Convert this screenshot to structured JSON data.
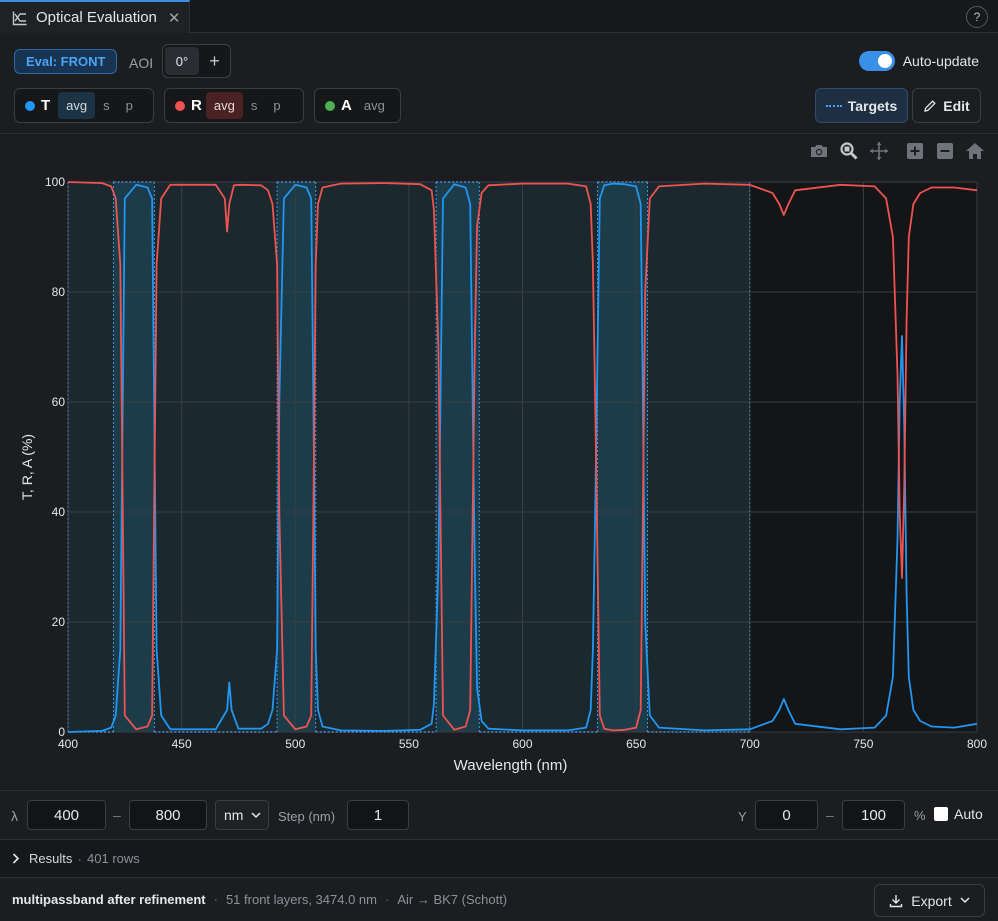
{
  "tab": {
    "title": "Optical Evaluation",
    "close": "✕",
    "help": "?"
  },
  "toolbar": {
    "eval_label": "Eval: FRONT",
    "aoi_label": "AOI",
    "aoi_value": "0°",
    "aoi_add": "+",
    "auto_update_label": "Auto-update",
    "auto_update_on": true,
    "channels": [
      {
        "letter": "T",
        "color": "#2196f3",
        "options": [
          "avg",
          "s",
          "p"
        ],
        "active": "avg"
      },
      {
        "letter": "R",
        "color": "#ef5350",
        "options": [
          "avg",
          "s",
          "p"
        ],
        "active": "avg"
      },
      {
        "letter": "A",
        "color": "#4caf50",
        "options": [
          "avg"
        ],
        "active": ""
      }
    ],
    "targets_label": "Targets",
    "edit_label": "Edit"
  },
  "chart_data": {
    "type": "line",
    "xlabel": "Wavelength (nm)",
    "ylabel": "T, R, A (%)",
    "xlim": [
      400,
      800
    ],
    "ylim": [
      0,
      100
    ],
    "xticks": [
      400,
      450,
      500,
      550,
      600,
      650,
      700,
      750,
      800
    ],
    "yticks": [
      0,
      20,
      40,
      60,
      80,
      100
    ],
    "grid": true,
    "target_bands": [
      {
        "x0": 400,
        "x1": 420,
        "type": "stop"
      },
      {
        "x0": 420,
        "x1": 438,
        "type": "pass"
      },
      {
        "x0": 438,
        "x1": 492,
        "type": "stop"
      },
      {
        "x0": 492,
        "x1": 509,
        "type": "pass"
      },
      {
        "x0": 509,
        "x1": 562,
        "type": "stop"
      },
      {
        "x0": 562,
        "x1": 581,
        "type": "pass"
      },
      {
        "x0": 581,
        "x1": 633,
        "type": "stop"
      },
      {
        "x0": 633,
        "x1": 655,
        "type": "pass"
      },
      {
        "x0": 655,
        "x1": 700,
        "type": "stop"
      }
    ],
    "series": [
      {
        "name": "T",
        "color": "#2196f3",
        "x": [
          400,
          415,
          419,
          421,
          423,
          425,
          430,
          435,
          437,
          439,
          441,
          445,
          465,
          470,
          471,
          472,
          475,
          485,
          488,
          490,
          492,
          493,
          495,
          500,
          505,
          507,
          508,
          509,
          510,
          512,
          520,
          540,
          555,
          560,
          561,
          563,
          565,
          570,
          575,
          577,
          579,
          580,
          582,
          585,
          600,
          620,
          628,
          630,
          631,
          632,
          634,
          636,
          640,
          645,
          650,
          652,
          653,
          654,
          656,
          660,
          680,
          700,
          710,
          713,
          715,
          717,
          720,
          740,
          755,
          760,
          763,
          765,
          766,
          767,
          768,
          769,
          770,
          772,
          775,
          780,
          790,
          800
        ],
        "y": [
          0,
          0.2,
          0.8,
          3,
          15,
          97,
          99.5,
          99,
          97,
          15,
          3,
          0.5,
          0.5,
          4,
          9,
          4,
          0.6,
          0.6,
          1.5,
          4,
          15,
          60,
          97,
          99.5,
          99,
          97,
          60,
          15,
          4,
          1,
          0.3,
          0.2,
          0.4,
          1.5,
          5,
          30,
          97,
          99.6,
          99,
          96,
          30,
          8,
          2,
          0.6,
          0.3,
          0.3,
          0.8,
          4,
          15,
          40,
          97,
          99.4,
          99.7,
          99.6,
          99.2,
          96,
          60,
          20,
          3,
          0.8,
          0.3,
          0.5,
          2,
          4,
          6,
          4,
          1.5,
          0.5,
          0.8,
          3,
          10,
          35,
          60,
          72,
          55,
          25,
          10,
          4,
          2,
          1,
          0.8,
          1.5
        ]
      },
      {
        "name": "R",
        "color": "#ef5350",
        "x": [
          400,
          415,
          419,
          421,
          423,
          425,
          430,
          435,
          437,
          439,
          441,
          445,
          465,
          469,
          470,
          471,
          473,
          476,
          485,
          488,
          490,
          492,
          493,
          495,
          500,
          505,
          507,
          508,
          509,
          510,
          512,
          520,
          540,
          555,
          560,
          561,
          563,
          565,
          570,
          575,
          577,
          579,
          580,
          582,
          585,
          600,
          620,
          628,
          630,
          631,
          632,
          634,
          636,
          640,
          645,
          650,
          652,
          653,
          654,
          656,
          660,
          680,
          700,
          710,
          713,
          715,
          717,
          720,
          740,
          755,
          760,
          763,
          765,
          766,
          767,
          768,
          769,
          770,
          772,
          775,
          780,
          790,
          800
        ],
        "y": [
          100,
          99.8,
          99.2,
          97,
          85,
          3,
          0.5,
          1,
          3,
          85,
          97,
          99.5,
          99.5,
          97,
          91,
          96,
          99.4,
          99.5,
          99.4,
          98.5,
          96,
          85,
          40,
          3,
          0.5,
          1,
          3,
          40,
          85,
          96,
          99,
          99.7,
          99.8,
          99.6,
          98.5,
          95,
          70,
          3,
          0.4,
          1,
          4,
          70,
          92,
          98,
          99.4,
          99.7,
          99.7,
          99.2,
          96,
          85,
          60,
          3,
          0.6,
          0.3,
          0.4,
          0.8,
          4,
          40,
          80,
          97,
          99.2,
          99.7,
          99.5,
          98,
          96,
          94,
          96,
          98.5,
          99.5,
          99.2,
          97,
          90,
          65,
          40,
          28,
          45,
          75,
          90,
          96,
          98,
          99,
          99,
          98.5
        ]
      }
    ]
  },
  "range": {
    "lambda_symbol": "λ",
    "from": "400",
    "to": "800",
    "dash": "–",
    "unit": "nm",
    "step_label": "Step (nm)",
    "step": "1",
    "y_label": "Y",
    "y_from": "0",
    "y_to": "100",
    "y_unit": "%",
    "auto_label": "Auto"
  },
  "results": {
    "label": "Results",
    "sep": "·",
    "count": "401 rows"
  },
  "footer": {
    "design_name": "multipassband after refinement",
    "sep": "·",
    "layers": "51 front layers, 3474.0 nm",
    "media": "Air → BK7 (Schott)",
    "export_label": "Export"
  }
}
